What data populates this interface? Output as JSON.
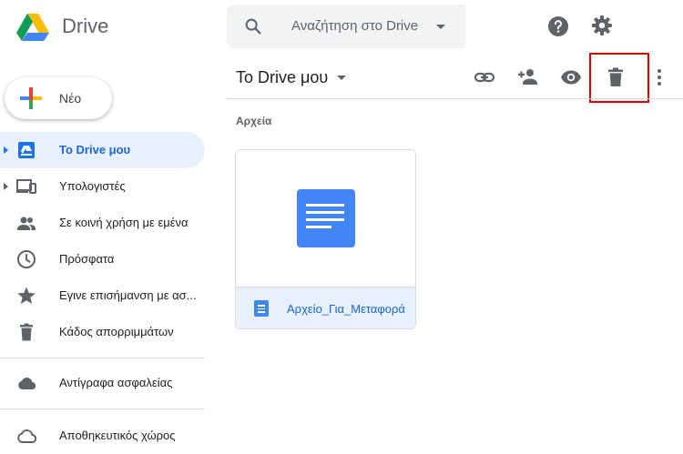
{
  "header": {
    "app_title": "Drive",
    "search_placeholder": "Αναζήτηση στο Drive"
  },
  "new_button": {
    "label": "Νέο"
  },
  "sidebar": {
    "items": [
      {
        "label": "Το Drive μου",
        "icon": "my-drive-icon",
        "active": true
      },
      {
        "label": "Υπολογιστές",
        "icon": "computers-icon"
      },
      {
        "label": "Σε κοινή χρήση με εμένα",
        "icon": "shared-icon"
      },
      {
        "label": "Πρόσφατα",
        "icon": "clock-icon"
      },
      {
        "label": "Εγινε επισήμανση με ασ...",
        "icon": "star-icon"
      },
      {
        "label": "Κάδος απορριμμάτων",
        "icon": "trash-icon"
      },
      {
        "label": "Αντίγραφα ασφαλείας",
        "icon": "cloud-icon"
      },
      {
        "label": "Αποθηκευτικός χώρος",
        "icon": "cloud-outline-icon"
      }
    ]
  },
  "main": {
    "breadcrumb": "Το Drive μου",
    "section_label": "Αρχεία",
    "files": [
      {
        "name": "Αρχείο_Για_Μεταφορά",
        "type": "doc"
      }
    ]
  },
  "colors": {
    "accent": "#1a73e8",
    "active_bg": "#e8f0fe",
    "doc_blue": "#4285f4",
    "highlight": "#e00000"
  }
}
